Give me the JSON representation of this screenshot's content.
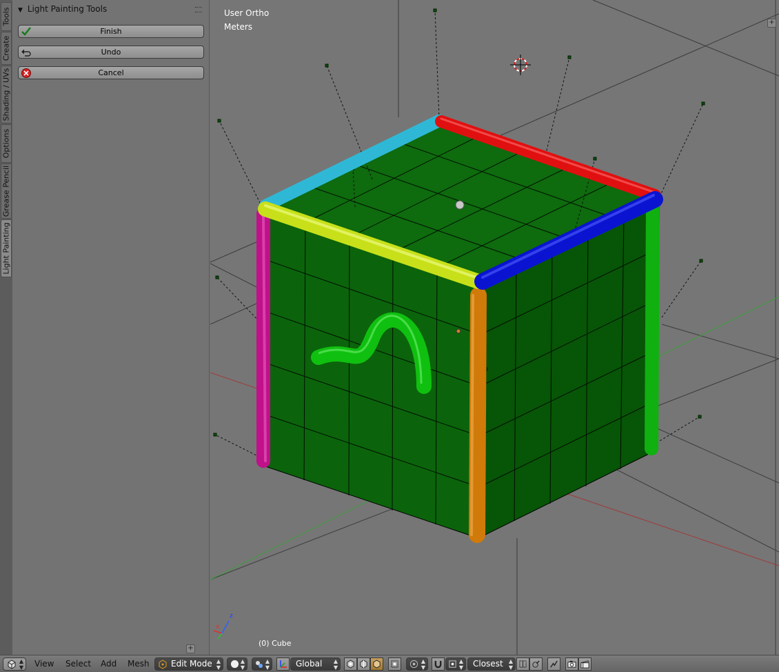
{
  "tabs": [
    {
      "label": "Tools",
      "active": false
    },
    {
      "label": "Create",
      "active": false
    },
    {
      "label": "Shading / UVs",
      "active": false
    },
    {
      "label": "Options",
      "active": false
    },
    {
      "label": "Grease Pencil",
      "active": false
    },
    {
      "label": "Light Painting",
      "active": true
    }
  ],
  "panel": {
    "title": "Light Painting Tools",
    "buttons": {
      "finish": "Finish",
      "undo": "Undo",
      "cancel": "Cancel"
    },
    "add_icon": "plus-icon"
  },
  "viewport": {
    "view_name": "User Ortho",
    "units": "Meters",
    "object_info": "(0) Cube",
    "axis_x": "x",
    "axis_z": "z"
  },
  "header": {
    "menus": {
      "view": "View",
      "select": "Select",
      "add": "Add",
      "mesh": "Mesh"
    },
    "mode": "Edit Mode",
    "orientation": "Global",
    "snap_target": "Closest"
  },
  "colors": {
    "cube_face_top": "#0e6b0e",
    "cube_face_left": "#0b620b",
    "cube_face_right": "#085808",
    "edge_cyan": "#2fb8d6",
    "edge_red": "#e01010",
    "edge_yellow": "#c8e01a",
    "edge_blue": "#0a14d0",
    "edge_magenta": "#c0108a",
    "edge_orange": "#d07a0a",
    "edge_green": "#10b010",
    "grid_x_axis": "#b04040",
    "grid_y_axis": "#40b040"
  }
}
